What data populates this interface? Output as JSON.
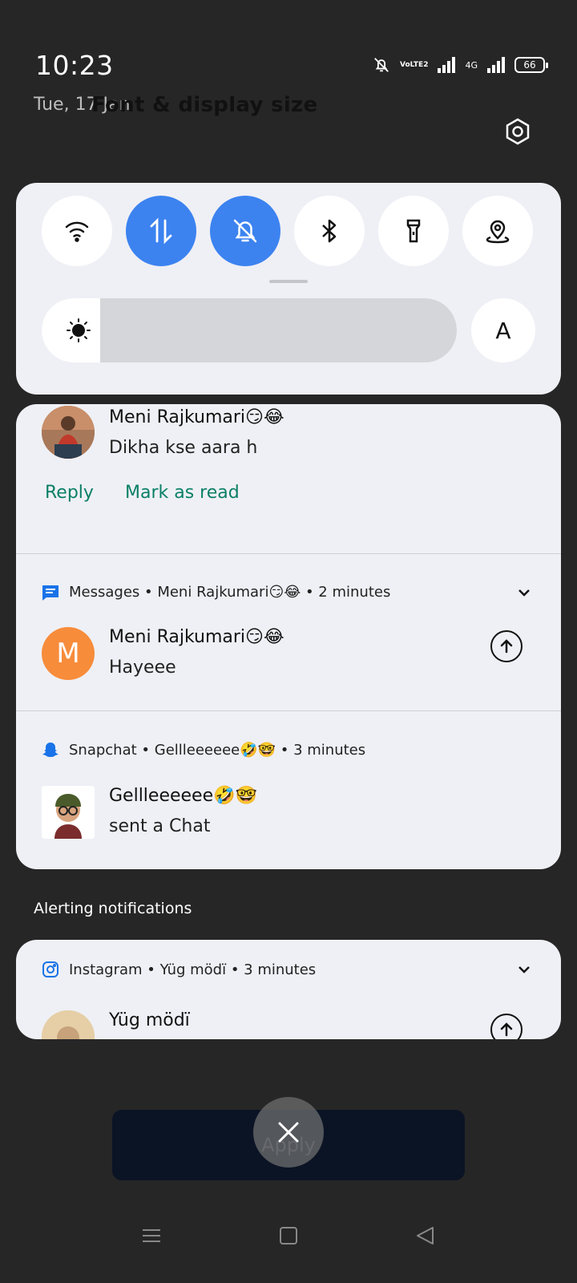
{
  "status_bar": {
    "time": "10:23",
    "date": "Tue, 17 Jan",
    "volte_top": "Vo",
    "volte_bottom": "LTE2",
    "network_type": "4G",
    "battery": "66"
  },
  "overlay": {
    "title": "Font & display size"
  },
  "quick_settings": {
    "tiles": [
      {
        "name": "wifi",
        "active": false
      },
      {
        "name": "mobile-data",
        "active": true
      },
      {
        "name": "silent",
        "active": true
      },
      {
        "name": "bluetooth",
        "active": false
      },
      {
        "name": "flashlight",
        "active": false
      },
      {
        "name": "location",
        "active": false
      }
    ],
    "brightness_level": 0.14,
    "auto_brightness_label": "A"
  },
  "notifications": {
    "first": {
      "sender": "Meni Rajkumari😏😂",
      "message": "Dikha kse aara h",
      "actions": [
        "Reply",
        "Mark as read"
      ]
    },
    "messages": {
      "app_header": "Messages • Meni Rajkumari😏😂 • 2 minutes",
      "avatar_letter": "M",
      "sender": "Meni Rajkumari😏😂",
      "message": "Hayeee"
    },
    "snapchat": {
      "app_header": "Snapchat • Gellleeeeee🤣🤓 • 3 minutes",
      "sender": "Gellleeeeee🤣🤓",
      "message": "sent a Chat"
    }
  },
  "alerting": {
    "label": "Alerting notifications",
    "instagram": {
      "app_header": "Instagram • Yüg mödï • 3 minutes",
      "sender": "Yüg mödï"
    }
  },
  "apply_label": "Apply",
  "colors": {
    "accent": "#3c83f0",
    "action_text": "#0a7f66",
    "messages_avatar": "#f78c3b",
    "panel_bg": "#eff0f5"
  }
}
